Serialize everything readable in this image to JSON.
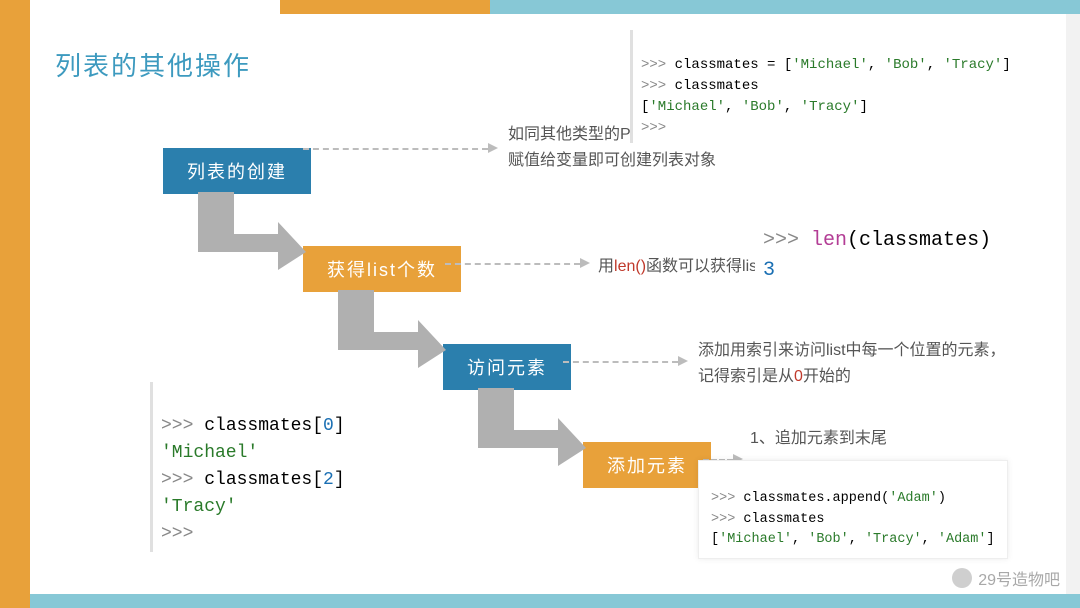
{
  "title": "列表的其他操作",
  "steps": {
    "s1": "列表的创建",
    "s2": "获得list个数",
    "s3": "访问元素",
    "s4": "添加元素"
  },
  "desc1": {
    "line1": "如同其他类型的Python对象变量一样，使用 \"=\" 直接将一个列表",
    "line2": "赋值给变量即可创建列表对象"
  },
  "desc2": {
    "prefix": "用",
    "fn": "len()",
    "suffix": "函数可以获得list元素的个数"
  },
  "desc3": {
    "line1": "添加用索引来访问list中每一个位置的元素，",
    "line2a": "记得索引是从",
    "line2_zero": "0",
    "line2b": "开始的"
  },
  "desc4": "1、追加元素到末尾",
  "code_top": {
    "l1_prompt": ">>> ",
    "l1_text": "classmates = [",
    "l1_s1": "'Michael'",
    "l1_c1": ", ",
    "l1_s2": "'Bob'",
    "l1_c2": ", ",
    "l1_s3": "'Tracy'",
    "l1_end": "]",
    "l2_prompt": ">>> ",
    "l2_text": "classmates",
    "l3": "[",
    "l3_s1": "'Michael'",
    "l3_c1": ", ",
    "l3_s2": "'Bob'",
    "l3_c2": ", ",
    "l3_s3": "'Tracy'",
    "l3_end": "]",
    "l4": ">>>"
  },
  "code_len": {
    "l1_prompt": ">>> ",
    "l1_fn": "len",
    "l1_open": "(",
    "l1_arg": "classmates",
    "l1_close": ")",
    "l2": "3"
  },
  "code_idx": {
    "l1_prompt": ">>> ",
    "l1_text": "classmates[",
    "l1_n": "0",
    "l1_end": "]",
    "l2": "'Michael'",
    "l3_prompt": ">>> ",
    "l3_text": "classmates[",
    "l3_n": "2",
    "l3_end": "]",
    "l4": "'Tracy'",
    "l5": ">>>"
  },
  "code_append": {
    "l1_prompt": ">>> ",
    "l1_text": "classmates.append(",
    "l1_s": "'Adam'",
    "l1_end": ")",
    "l2_prompt": ">>> ",
    "l2_text": "classmates",
    "l3_open": "[",
    "l3_s1": "'Michael'",
    "l3_c1": ", ",
    "l3_s2": "'Bob'",
    "l3_c2": ", ",
    "l3_s3": "'Tracy'",
    "l3_c3": ", ",
    "l3_s4": "'Adam'",
    "l3_end": "]"
  },
  "watermark": "29号造物吧"
}
